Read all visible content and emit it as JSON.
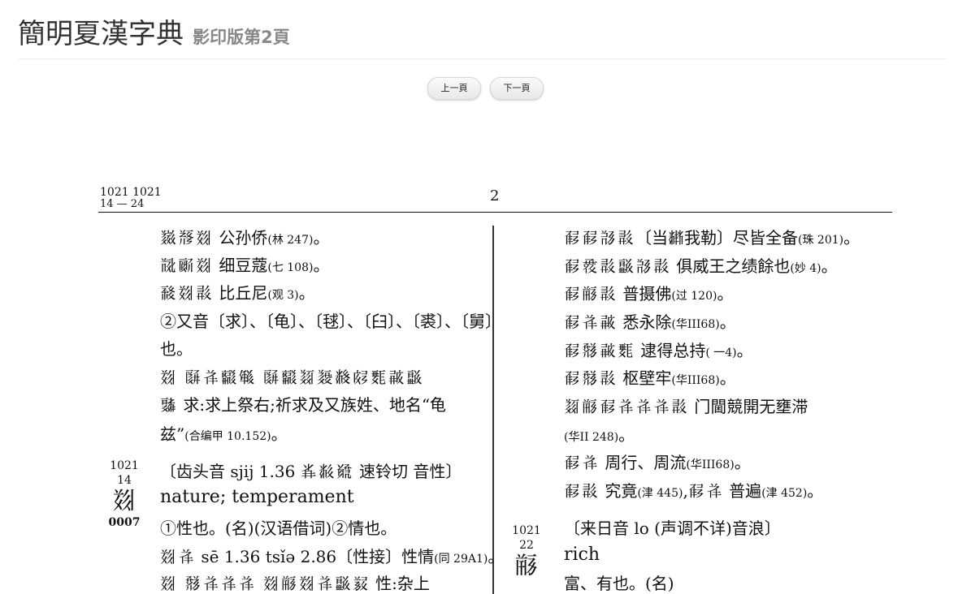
{
  "header": {
    "title": "簡明夏漢字典",
    "subtitle": "影印版第2頁"
  },
  "nav": {
    "prev": "上一頁",
    "next": "下一頁"
  },
  "scan": {
    "running_head": {
      "top": "1021 1021",
      "bottom": "14 — 24"
    },
    "page_number": "2",
    "left_column": [
      {
        "tangut": "𘑄𘃡𘋨",
        "text": " 公孙侨",
        "ref": "(林 247)",
        "end": "。"
      },
      {
        "tangut": "𘁟𘞞𘋨",
        "text": " 细豆蔻",
        "ref": "(七 108)",
        "end": "。"
      },
      {
        "tangut": "𘈷𘋨𘗽",
        "text": " 比丘尼",
        "ref": "(观 3)",
        "end": "。"
      },
      {
        "tangut": "",
        "text": "②又音〔求〕、〔龟〕、〔毬〕、〔臼〕、〔裘〕、〔舅〕",
        "ref": "",
        "end": ""
      },
      {
        "tangut": "",
        "text": "也。",
        "ref": "",
        "end": ""
      },
      {
        "tangut": "𘋨 𘚔𘗐𘔇𘓟 𘚔𘔇𘏤𘐀𘂜𘊴𘜩𘑮𘞙",
        "text": "",
        "ref": "",
        "end": ""
      },
      {
        "tangut": "𘚜",
        "text": " 求:求上祭右;祈求及又族姓、地名“龟",
        "ref": "",
        "end": ""
      },
      {
        "tangut": "",
        "text": "兹”",
        "ref": "(合编甲 10.152)",
        "end": "。"
      }
    ],
    "entry1": {
      "num": "1021",
      "sub": "14",
      "glyph": "𘋨",
      "code": "0007"
    },
    "entry1_lines": [
      {
        "tangut": "",
        "text": "〔齿头音 sjij 1.36 ",
        "tangut2": "𘕰𘂎𘍦",
        "text2": " 速铃切 音性〕",
        "ref": "",
        "end": ""
      },
      {
        "tangut": "",
        "text": "nature; temperament",
        "ref": "",
        "end": ""
      },
      {
        "tangut": "",
        "text": "①性也。(名)(汉语借词)②情也。",
        "ref": "",
        "end": ""
      },
      {
        "tangut": "𘋨𘗐",
        "text": " sē 1.36  tsǐə 2.86〔性接〕性情",
        "ref": "(同 29A1)",
        "end": "。"
      },
      {
        "tangut": "𘋨 𘜕𘗐𘗐𘗐 𘋨𘛐𘋨𘗐𘞙𘁿",
        "text": " 性:杂上",
        "ref": "",
        "end": ""
      }
    ],
    "right_column": [
      {
        "tangut": "𘒣𘒣𘍳𘗽",
        "text": "〔当𘂤我勒〕尽皆全备",
        "ref": "(珠 201)",
        "end": "。"
      },
      {
        "tangut": "𘒣𘒆𘗽𘞙𘍳𘗽",
        "text": " 俱威王之绩餘也",
        "ref": "(妙 4)",
        "end": "。"
      },
      {
        "tangut": "𘒣𘛐𘗽",
        "text": " 普摄佛",
        "ref": "(过 120)",
        "end": "。"
      },
      {
        "tangut": "𘒣𘗐𘑮",
        "text": " 悉永除",
        "ref": "(华III68)",
        "end": "。"
      },
      {
        "tangut": "𘒣𘜕𘑮𘜩",
        "text": " 逮得总持",
        "ref": "( 一4)",
        "end": "。"
      },
      {
        "tangut": "𘒣𘜕𘗽",
        "text": " 枢壁牢",
        "ref": "(华III68)",
        "end": "。"
      },
      {
        "tangut": "𘏤𘛐𘒣𘗐𘗐𘗐𘗽",
        "text": " 门閫競開无壅滞",
        "ref": "",
        "end": ""
      },
      {
        "tangut": "",
        "text": "",
        "ref": "(华II 248)",
        "end": "。"
      },
      {
        "tangut": "𘒣𘗐",
        "text": " 周行、周流",
        "ref": "(华III68)",
        "end": "。"
      },
      {
        "tangut": "𘒣𘗽",
        "text": " 究竟",
        "ref": "(津 445)",
        "text2": ",",
        "tangut2": "𘒣𘗐",
        "text3": " 普遍",
        "ref2": "(津 452)",
        "end": "。"
      }
    ],
    "entry2": {
      "num": "1021",
      "sub": "22",
      "glyph": "𘛐"
    },
    "entry2_lines": [
      {
        "text": "〔来日音 lo (声调不详)音浪〕"
      },
      {
        "text": "rich"
      },
      {
        "text": "富、有也。(名)"
      }
    ]
  }
}
